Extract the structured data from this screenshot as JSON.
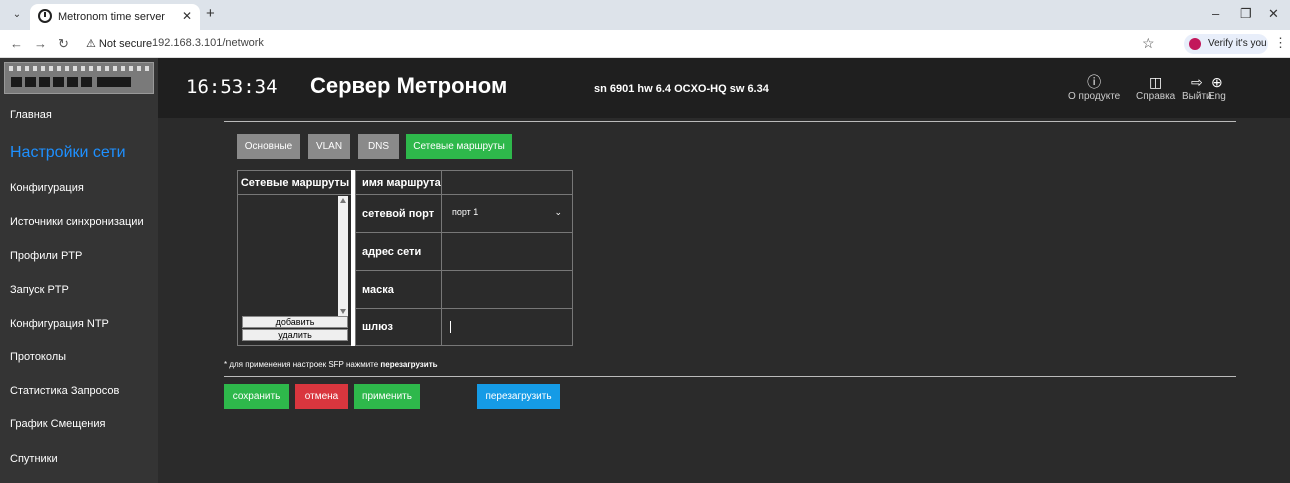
{
  "browser": {
    "tab_title": "Metronom time server",
    "not_secure": "Not secure",
    "url": "192.168.3.101/network",
    "verify": "Verify it's you"
  },
  "sidebar": {
    "items": [
      {
        "label": "Главная"
      },
      {
        "label": "Настройки сети",
        "active": true
      },
      {
        "label": "Конфигурация"
      },
      {
        "label": "Источники синхронизации"
      },
      {
        "label": "Профили PTP"
      },
      {
        "label": "Запуск PTP"
      },
      {
        "label": "Конфигурация NTP"
      },
      {
        "label": "Протоколы"
      },
      {
        "label": "Статистика Запросов"
      },
      {
        "label": "График Смещения"
      },
      {
        "label": "Спутники"
      }
    ]
  },
  "header": {
    "clock": "16:53:34",
    "title": "Сервер Метроном",
    "info": "sn 6901 hw 6.4 OCXO-HQ sw 6.34",
    "buttons": {
      "about": "О продукте",
      "help": "Справка",
      "logout": "Выйти",
      "lang": "Eng"
    }
  },
  "tabs": {
    "basic": "Основные",
    "vlan": "VLAN",
    "dns": "DNS",
    "routes": "Сетевые маршруты"
  },
  "routes_panel": {
    "header": "Сетевые маршруты",
    "add": "добавить",
    "remove": "удалить"
  },
  "form": {
    "route_name": "имя маршрута",
    "port": "сетевой порт",
    "port_value": "порт 1",
    "network": "адрес сети",
    "mask": "маска",
    "gateway": "шлюз"
  },
  "note": {
    "text": "* для применения настроек SFP нажмите ",
    "bold": "перезагрузить"
  },
  "actions": {
    "save": "сохранить",
    "cancel": "отмена",
    "apply": "применить",
    "reboot": "перезагрузить"
  },
  "colors": {
    "active_tab": "#2eb84b",
    "inactive_tab": "#8a8a8a",
    "save": "#2eb84b",
    "cancel": "#d9363e",
    "apply": "#2eb84b",
    "reboot": "#159be6",
    "active_sidebar": "#1e90ff"
  }
}
